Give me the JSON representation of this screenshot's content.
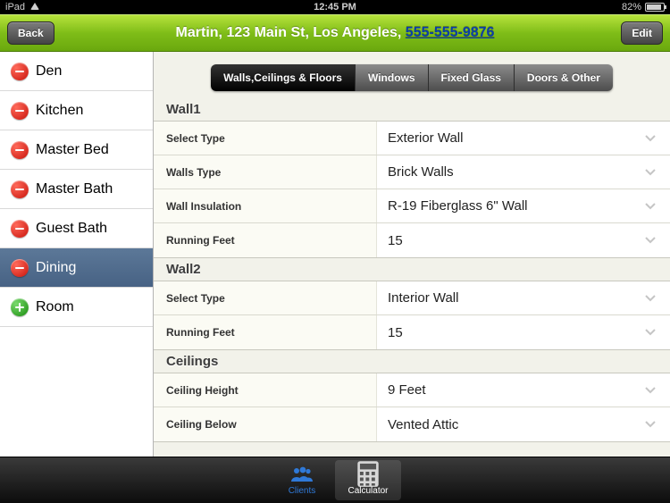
{
  "statusbar": {
    "device": "iPad",
    "time": "12:45 PM",
    "battery": "82%"
  },
  "navbar": {
    "back_label": "Back",
    "edit_label": "Edit",
    "title_prefix": "Martin, 123 Main St, Los Angeles, ",
    "phone": "555-555-9876"
  },
  "sidebar": {
    "items": [
      {
        "label": "Den",
        "icon": "minus",
        "selected": false
      },
      {
        "label": "Kitchen",
        "icon": "minus",
        "selected": false
      },
      {
        "label": "Master Bed",
        "icon": "minus",
        "selected": false
      },
      {
        "label": "Master Bath",
        "icon": "minus",
        "selected": false
      },
      {
        "label": "Guest Bath",
        "icon": "minus",
        "selected": false
      },
      {
        "label": "Dining",
        "icon": "minus",
        "selected": true
      },
      {
        "label": "Room",
        "icon": "plus",
        "selected": false
      }
    ]
  },
  "segments": {
    "items": [
      {
        "label": "Walls,Ceilings & Floors",
        "active": true
      },
      {
        "label": "Windows",
        "active": false
      },
      {
        "label": "Fixed Glass",
        "active": false
      },
      {
        "label": "Doors & Other",
        "active": false
      }
    ]
  },
  "sections": [
    {
      "title": "Wall1",
      "rows": [
        {
          "label": "Select Type",
          "value": "Exterior Wall"
        },
        {
          "label": "Walls Type",
          "value": "Brick Walls"
        },
        {
          "label": "Wall Insulation",
          "value": "R-19 Fiberglass 6\" Wall"
        },
        {
          "label": "Running Feet",
          "value": "15"
        }
      ]
    },
    {
      "title": "Wall2",
      "rows": [
        {
          "label": "Select Type",
          "value": "Interior Wall"
        },
        {
          "label": "Running Feet",
          "value": "15"
        }
      ]
    },
    {
      "title": "Ceilings",
      "rows": [
        {
          "label": "Ceiling Height",
          "value": "9 Feet"
        },
        {
          "label": "Ceiling Below",
          "value": "Vented Attic"
        }
      ]
    }
  ],
  "tabbar": {
    "clients_label": "Clients",
    "calculator_label": "Calculator"
  }
}
